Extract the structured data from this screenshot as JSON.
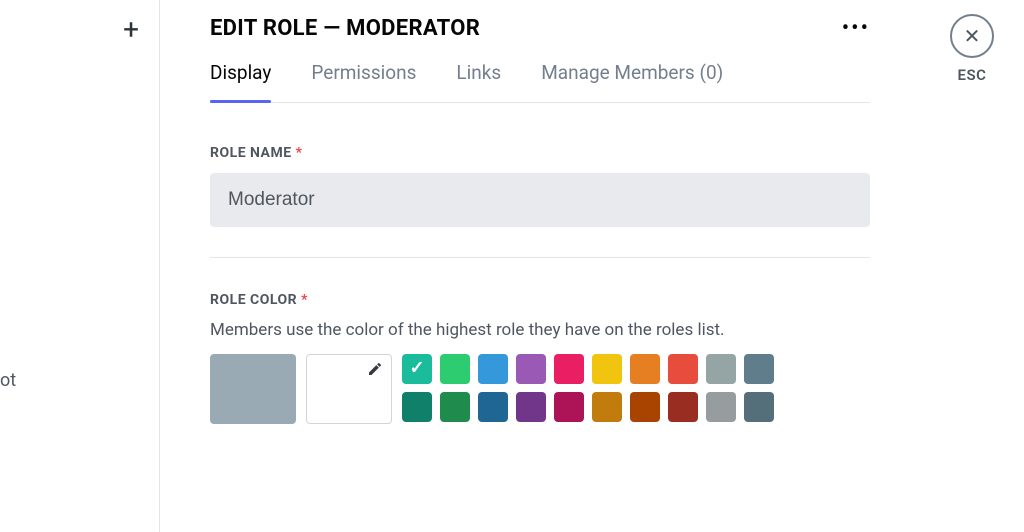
{
  "sidebar": {
    "plus_label": "+",
    "fragment_text": "ot"
  },
  "header": {
    "title": "EDIT ROLE — MODERATOR",
    "more_label": "•••"
  },
  "tabs": [
    {
      "label": "Display",
      "active": true
    },
    {
      "label": "Permissions",
      "active": false
    },
    {
      "label": "Links",
      "active": false
    },
    {
      "label": "Manage Members (0)",
      "active": false
    }
  ],
  "role_name": {
    "label": "ROLE NAME",
    "required_marker": "*",
    "value": "Moderator"
  },
  "role_color": {
    "label": "ROLE COLOR",
    "required_marker": "*",
    "helper": "Members use the color of the highest role they have on the roles list.",
    "default_swatch": "#99aab5",
    "selected_index": 0,
    "row1": [
      "#1abc9c",
      "#2ecc71",
      "#3498db",
      "#9b59b6",
      "#e91e63",
      "#f1c40f",
      "#e67e22",
      "#e74c3c",
      "#95a5a6",
      "#607d8b"
    ],
    "row2": [
      "#11806a",
      "#1f8b4c",
      "#206694",
      "#71368a",
      "#ad1457",
      "#c27c0e",
      "#a84300",
      "#992d22",
      "#979c9f",
      "#546e7a"
    ]
  },
  "close": {
    "x_glyph": "✕",
    "esc_label": "ESC"
  }
}
